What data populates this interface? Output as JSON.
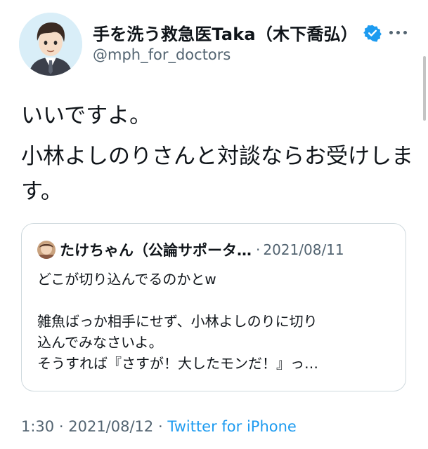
{
  "author": {
    "display_name": "手を洗う救急医Taka（木下喬弘）",
    "handle": "@mph_for_doctors",
    "verified": true
  },
  "tweet": {
    "paragraphs": [
      "いいですよ。",
      "小林よしのりさんと対談ならお受けします。"
    ]
  },
  "quoted_tweet": {
    "author_name": "たけちゃん（公論サポータ…",
    "separator": "·",
    "date": "2021/08/11",
    "lines": [
      "どこが切り込んでるのかとw",
      "雑魚ばっか相手にせず、小林よしのりに切り",
      "込んでみなさいよ。",
      "そうすれば『さすが！大したモンだ！』っ…"
    ]
  },
  "meta": {
    "time": "1:30",
    "separator": "·",
    "date": "2021/08/12",
    "source": "Twitter for iPhone"
  },
  "colors": {
    "text": "#0f1419",
    "secondary": "#536471",
    "accent": "#1d9bf0",
    "border": "#cfd9de"
  },
  "icons": [
    "avatar-illustration",
    "verified-badge-icon",
    "more-options-icon"
  ]
}
